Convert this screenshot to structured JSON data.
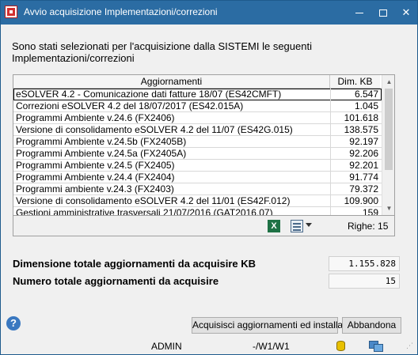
{
  "window": {
    "title": "Avvio acquisizione Implementazioni/correzioni"
  },
  "intro": {
    "line1": "Sono stati selezionati per l'acquisizione dalla SISTEMI le seguenti",
    "line2": "Implementazioni/correzioni"
  },
  "grid": {
    "headers": {
      "name": "Aggiornamenti",
      "size": "Dim. KB"
    },
    "rows": [
      {
        "name": "eSOLVER 4.2 - Comunicazione dati fatture 18/07 (ES42CMFT)",
        "size": "6.547"
      },
      {
        "name": "Correzioni eSOLVER 4.2 del 18/07/2017 (ES42.015A)",
        "size": "1.045"
      },
      {
        "name": "Programmi Ambiente v.24.6 (FX2406)",
        "size": "101.618"
      },
      {
        "name": "Versione di consolidamento eSOLVER 4.2 del 11/07 (ES42G.015)",
        "size": "138.575"
      },
      {
        "name": "Programmi Ambiente v.24.5b (FX2405B)",
        "size": "92.197"
      },
      {
        "name": "Programmi Ambiente v.24.5a (FX2405A)",
        "size": "92.206"
      },
      {
        "name": "Programmi Ambiente v.24.5 (FX2405)",
        "size": "92.201"
      },
      {
        "name": "Programmi Ambiente v.24.4 (FX2404)",
        "size": "91.774"
      },
      {
        "name": "Programmi ambiente v.24.3 (FX2403)",
        "size": "79.372"
      },
      {
        "name": "Versione di consolidamento eSOLVER 4.2 del 11/01 (ES42F.012)",
        "size": "109.900"
      },
      {
        "name": "Gestioni amministrative trasversali 21/07/2016 (GAT2016.07)",
        "size": "159"
      }
    ],
    "footer": {
      "excel_icon_glyph": "X",
      "rows_label": "Righe: 15"
    }
  },
  "summary": {
    "total_size_label": "Dimensione totale aggiornamenti da acquisire KB",
    "total_size_value": "1.155.828",
    "total_count_label": "Numero totale aggiornamenti da acquisire",
    "total_count_value": "15"
  },
  "buttons": {
    "help": "?",
    "acquire": "Acquisisci aggiornamenti ed installa",
    "cancel": "Abbandona"
  },
  "status": {
    "user": "ADMIN",
    "path": "-/W1/W1"
  }
}
